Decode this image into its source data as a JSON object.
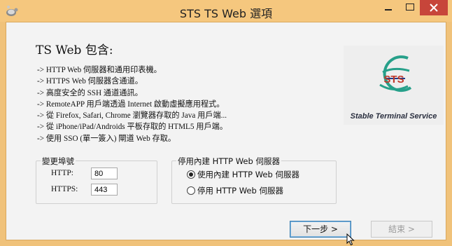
{
  "window": {
    "title": "STS TS Web 選項",
    "app_icon": "tortoise-app-icon",
    "controls": {
      "minimize": "minimize-icon",
      "maximize": "maximize-icon",
      "close": "close-icon"
    }
  },
  "main": {
    "heading": "TS Web 包含:",
    "features": [
      "-> HTTP Web 伺服器和通用印表機。",
      "-> HTTPS Web 伺服器含通道。",
      "-> 高度安全的 SSH 通道通訊。",
      "-> RemoteAPP 用戶端透過 Internet 啟動虛擬應用程式。",
      "-> 從 Firefox, Safari, Chrome 瀏覽器存取的 Java 用戶端...",
      "-> 從 iPhone/iPad/Androids 平板存取的 HTML5 用戶端。",
      "-> 使用 SSO (單一簽入) 閘道 Web 存取。"
    ],
    "logo": {
      "letters": "STS",
      "caption": "Stable Terminal Service"
    }
  },
  "ports": {
    "legend": "變更埠號",
    "http_label": "HTTP:",
    "http_value": "80",
    "https_label": "HTTPS:",
    "https_value": "443"
  },
  "server": {
    "legend": "停用內建 HTTP Web 伺服器",
    "options": [
      {
        "label": "使用內建 HTTP Web 伺服器",
        "checked": true
      },
      {
        "label": "停用 HTTP Web 伺服器",
        "checked": false
      }
    ]
  },
  "buttons": {
    "next": "下一步 >",
    "finish": "結束 >"
  },
  "colors": {
    "titlebar": "#f5c77e",
    "close": "#c7453a",
    "accent": "#3c7fb1"
  }
}
